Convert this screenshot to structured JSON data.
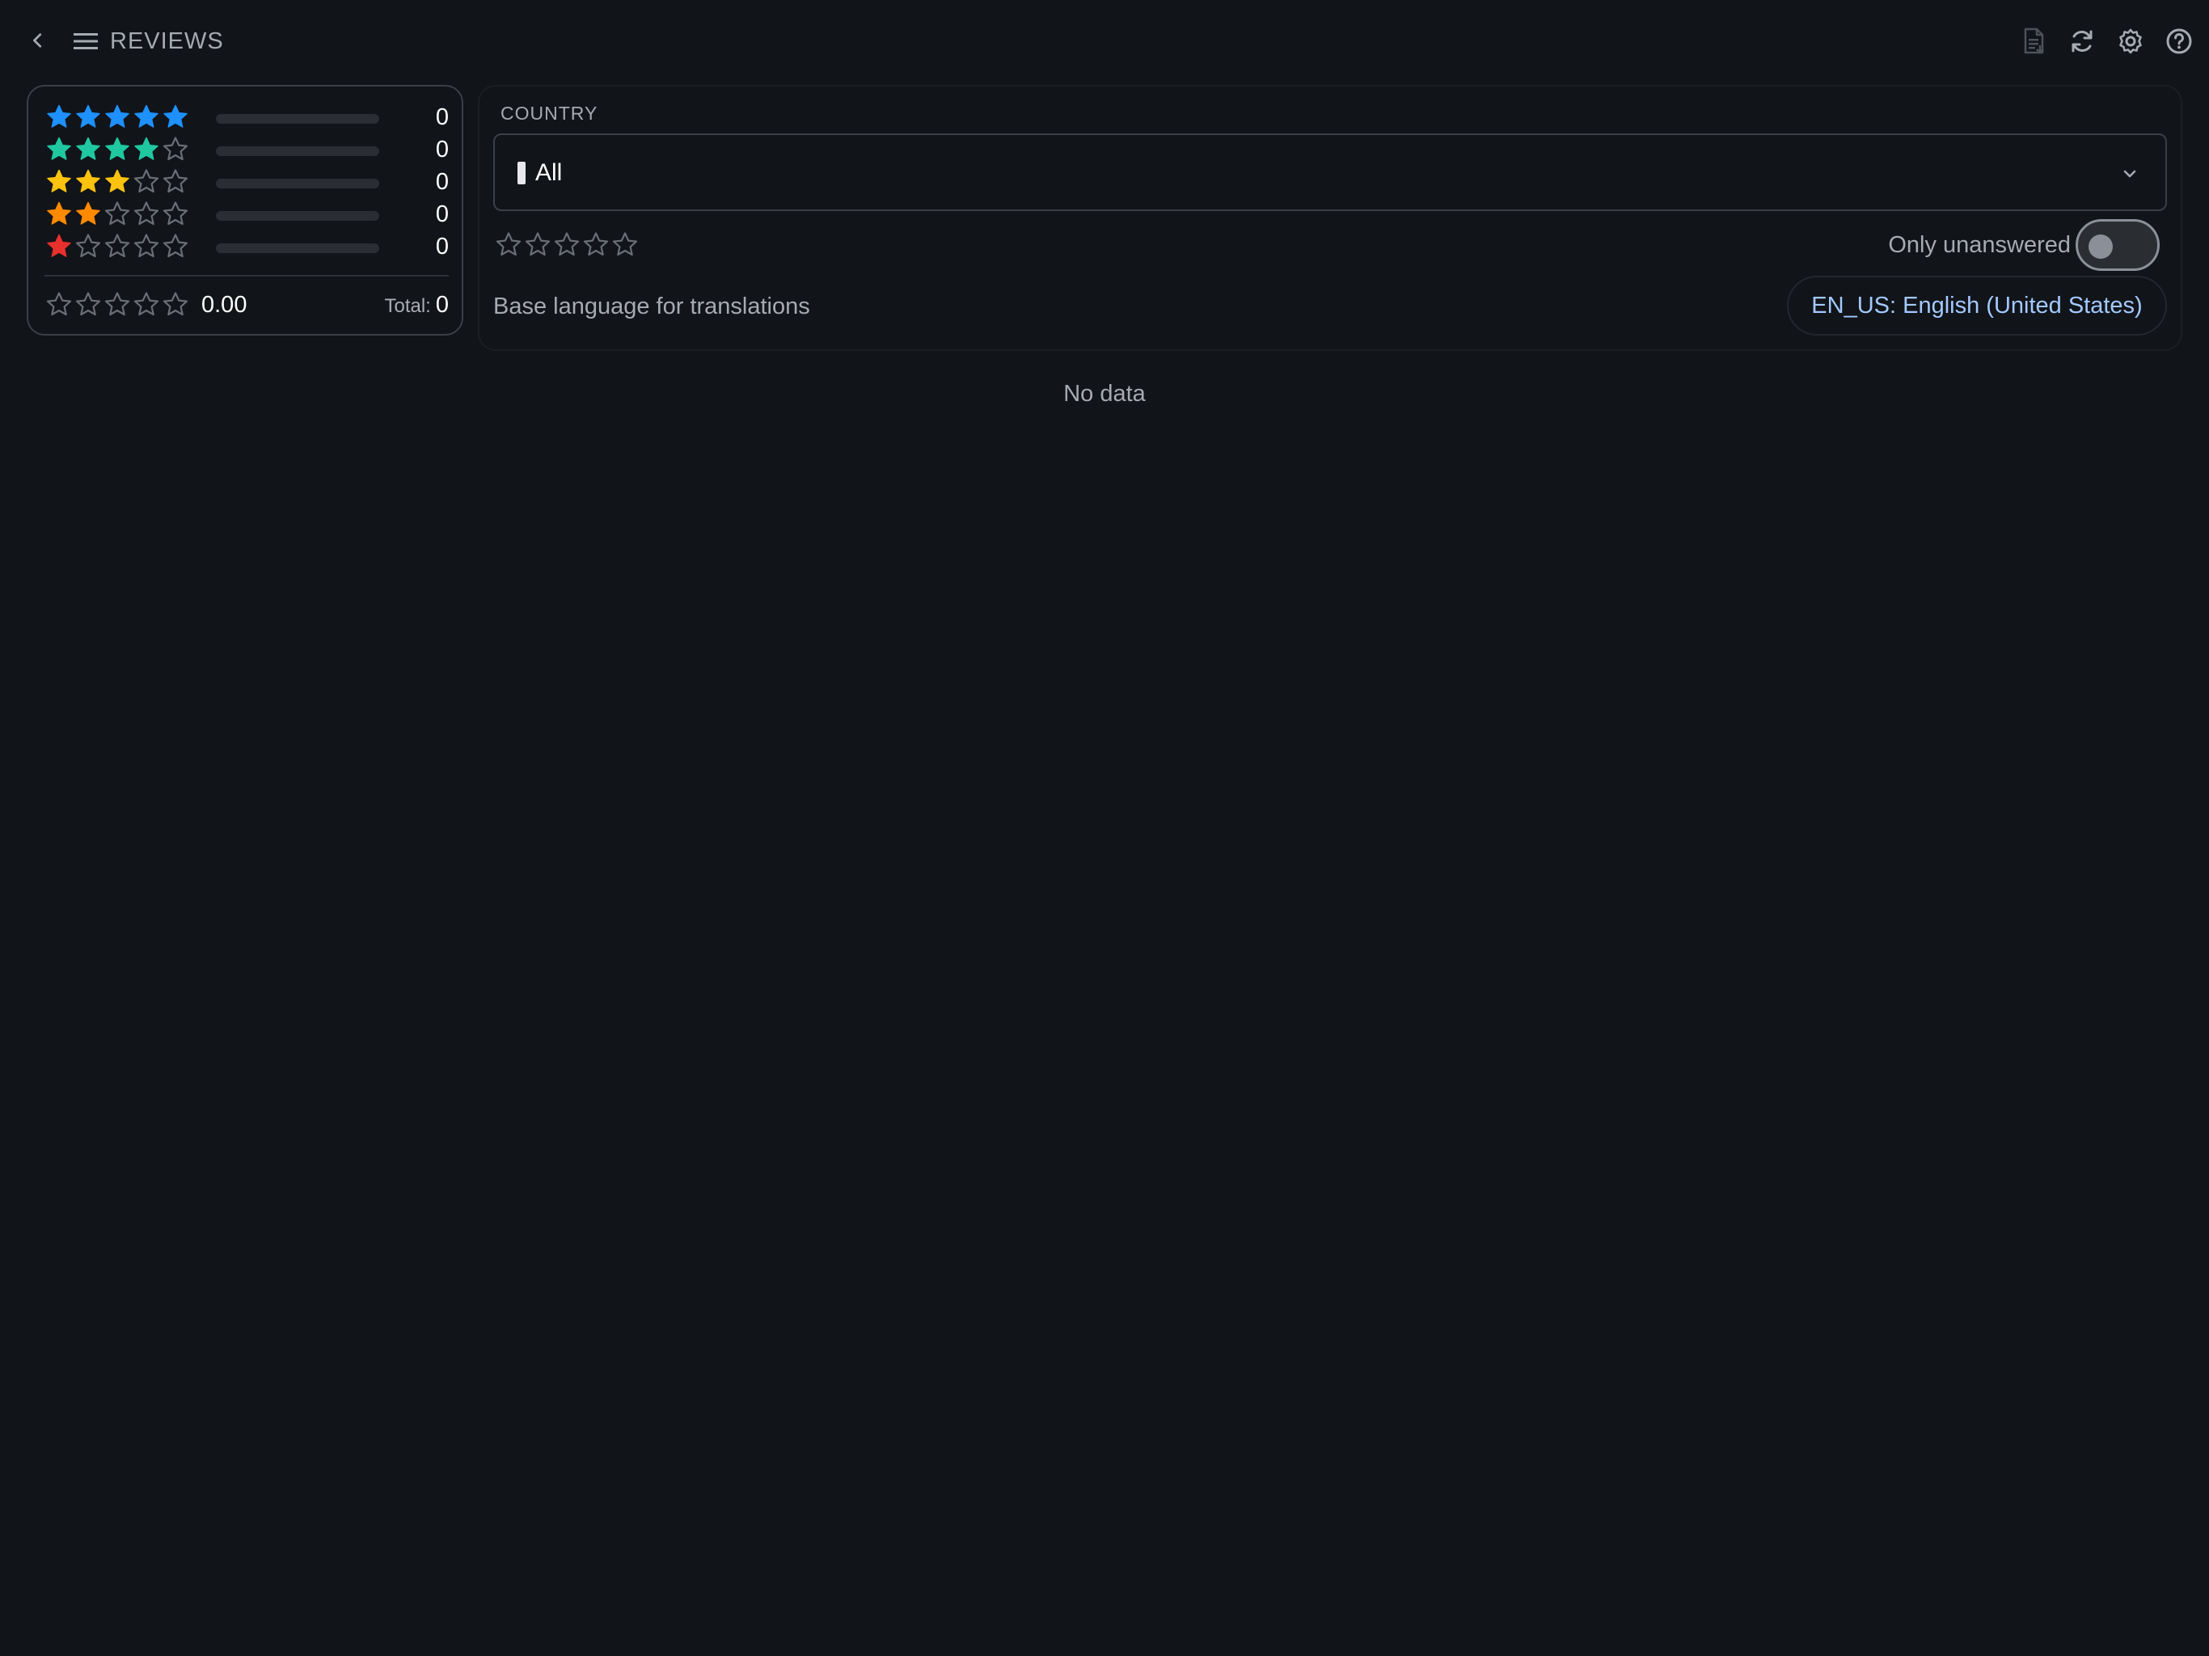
{
  "header": {
    "title": "REVIEWS",
    "back_icon": "chevron-left-icon",
    "menu_icon": "hamburger-menu-icon",
    "actions": [
      {
        "name": "export-report-icon"
      },
      {
        "name": "refresh-icon"
      },
      {
        "name": "settings-gear-icon"
      },
      {
        "name": "help-circle-icon"
      }
    ]
  },
  "summary": {
    "rows": [
      {
        "stars": 5,
        "color": "#1e90ff",
        "count": "0",
        "fraction": 0
      },
      {
        "stars": 4,
        "color": "#1fc8a0",
        "count": "0",
        "fraction": 0
      },
      {
        "stars": 3,
        "color": "#ffc20e",
        "count": "0",
        "fraction": 0
      },
      {
        "stars": 2,
        "color": "#ff8a00",
        "count": "0",
        "fraction": 0
      },
      {
        "stars": 1,
        "color": "#e8302c",
        "count": "0",
        "fraction": 0
      }
    ],
    "average_rating": 0,
    "average_label": "0.00",
    "total_label": "Total:",
    "total_value": "0"
  },
  "filters": {
    "country_label": "COUNTRY",
    "country_value": "All",
    "star_filter_selected": 0,
    "only_unanswered_label": "Only unanswered",
    "only_unanswered_on": false,
    "base_language_label": "Base language for translations",
    "base_language_value": "EN_US: English (United States)"
  },
  "empty_state": "No data",
  "colors": {
    "background": "#111419",
    "empty_star": "#6a6e75",
    "accent_link": "#a3c9ff"
  }
}
